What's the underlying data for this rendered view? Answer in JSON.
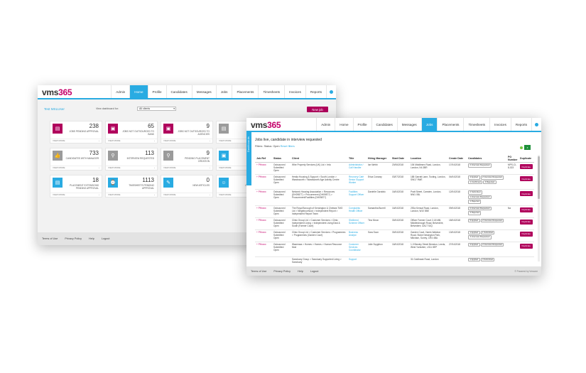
{
  "back": {
    "logo": {
      "part1": "vms",
      "part2": "365"
    },
    "nav": [
      "Admin",
      "Home",
      "Profile",
      "Candidates",
      "Messages",
      "Jobs",
      "Placements",
      "Timesheets",
      "Invoices",
      "Reports"
    ],
    "active_nav": "Home",
    "welcome": "Test MSLUser",
    "dashboard_for_label": "View dashboard for:",
    "dashboard_for_value": "All clients",
    "new_job_label": "New job",
    "tiles": [
      {
        "num": "238",
        "label": "Jobs pending approval",
        "icon": "clipboard-icon",
        "color": "pink"
      },
      {
        "num": "65",
        "label": "Jobs not outsourced to bank",
        "icon": "save-icon",
        "color": "pink"
      },
      {
        "num": "9",
        "label": "Jobs not outsourced to agencies",
        "icon": "save-icon",
        "color": "pink"
      },
      {
        "num": "",
        "label": "",
        "icon": "clipboard-icon",
        "color": "grey"
      },
      {
        "num": "733",
        "label": "Candidates with manager",
        "icon": "thumbs-up-icon",
        "color": "grey"
      },
      {
        "num": "113",
        "label": "Interview requested",
        "icon": "user-search-icon",
        "color": "grey"
      },
      {
        "num": "9",
        "label": "Pending placement creation",
        "icon": "user-search-icon",
        "color": "grey"
      },
      {
        "num": "",
        "label": "",
        "icon": "save-icon",
        "color": "blue"
      },
      {
        "num": "18",
        "label": "Placement extensions pending approval",
        "icon": "clipboard-icon",
        "color": "blue"
      },
      {
        "num": "1113",
        "label": "Timesheets pending approval",
        "icon": "timesheet-icon",
        "color": "blue"
      },
      {
        "num": "0",
        "label": "New articles",
        "icon": "article-icon",
        "color": "blue"
      },
      {
        "num": "",
        "label": "Candidates in c",
        "icon": "user-icon",
        "color": "blue"
      }
    ],
    "view_more": "View more",
    "footer": [
      "Terms of Use",
      "Privacy Policy",
      "Help",
      "Logout"
    ]
  },
  "front": {
    "logo": {
      "part1": "vms",
      "part2": "365"
    },
    "nav": [
      "Admin",
      "Home",
      "Profile",
      "Candidates",
      "Messages",
      "Jobs",
      "Placements",
      "Timesheets",
      "Invoices",
      "Reports"
    ],
    "active_nav": "Jobs",
    "side_tab": "Dashboards",
    "title": "Jobs live, candidate in interview requested",
    "filters_prefix": "Filters: Status: Open",
    "reset_filters": "Reset filters",
    "columns": [
      "Job Ref",
      "Status",
      "Client",
      "Title",
      "Hiring Manager",
      "Start Date",
      "Location",
      "Create Date",
      "Candidates",
      "PO Number",
      "Duplicate"
    ],
    "rows": [
      {
        "ref": "PHxxxx",
        "status": "Outsourced Submitted Open",
        "client": "Whe Property Services (UK) Ltd > Irrla",
        "title": "Administrator / Call Handler",
        "manager": "Ian Webb",
        "start": "20/06/2018",
        "location": "106 Middlesex Road, London, London, N4 3BR",
        "create": "17/04/2018",
        "candidates": [
          "2 Interview Requested"
        ],
        "po": "MPS-CI-8-023",
        "dup": "Duplicate",
        "tall": false
      },
      {
        "ref": "PHxxxx",
        "status": "Outsourced Submitted Open",
        "client": "Hestia Housing & Support > South London > Wandsworth > Wandsworth Age Activity Centre",
        "title": "Recovery Café Senior Support Worker",
        "manager": "Erica Conway",
        "start": "03/07/2018",
        "location": "188 Garratt Lane, Tooting, London, SW17 9WE",
        "create": "04/04/2018",
        "candidates": [
          "4 Applied",
          "2 Interview Requested",
          "1 Confirmed",
          "3 Rejected"
        ],
        "po": "",
        "dup": "Duplicate",
        "tall": true
      },
      {
        "ref": "PHxxxx",
        "status": "Outsourced Submitted Open",
        "client": "Network Housing Association > Resources (DH09877) > Procurement (DH09877) > Procurement/Facilities (DH09877)",
        "title": "Facilities Support Officer",
        "manager": "Danielle Garofalo",
        "start": "16/04/2018",
        "location": "Pratt Street, Camden, London, NW1 0BL",
        "create": "12/04/2018",
        "candidates": [
          "2 Submitted",
          "1 Interview Requested",
          "1 Rejected"
        ],
        "po": "",
        "dup": "Duplicate",
        "tall": true
      },
      {
        "ref": "PHxxxx",
        "status": "Outsourced Submitted Open",
        "client": "The Royal Borough of Kensington & Chelsea TMO Ltd > Neighbourhood > Independent Report > Independent Report Team",
        "title": "Complaints Health Officer",
        "manager": "Samantha Burrell",
        "start": "16/04/2018",
        "location": "292a Kensal Road, London, London, W10 5BE",
        "create": "09/04/2018",
        "candidates": [
          "2 Interview Requested",
          "4 Rejected"
        ],
        "po": "Na",
        "dup": "Duplicate",
        "tall": false
      },
      {
        "ref": "PHxxxx",
        "status": "Outsourced Submitted Open",
        "client": "Clinic Group Ltd > Customer Services > Clinic Independent Living > Independent Living East & South (Farmer Court)",
        "title": "Sheltered Scheme Officer",
        "manager": "Tina Nixon",
        "start": "30/04/2018",
        "location": "Officer Farmer Court 2-18 Mill, Middlesbrough Road, Belvedere, Belvedere, DA17 5JQ",
        "create": "18/04/2018",
        "candidates": [
          "5 Applied",
          "2 Interview Requested"
        ],
        "po": "",
        "dup": "Duplicate",
        "tall": false
      },
      {
        "ref": "PHxxxx",
        "status": "Outsourced Submitted Open",
        "client": "Clinic Group Ltd > Customer Services > Programmes > Programmes (Garden Court)",
        "title": "Business Analyst",
        "manager": "Sara Soon",
        "start": "30/04/2018",
        "location": "Garden Court, Harris Waldron Road, Stoke Newington Park, Mitcham, Surrey, CR4 4BA",
        "create": "13/04/2018",
        "candidates": [
          "1 Applied",
          "1 Submitted",
          "3 Interview Requested"
        ],
        "po": "",
        "dup": "Duplicate",
        "tall": false
      },
      {
        "ref": "PHxxxx",
        "status": "Outsourced Submitted Open",
        "client": "Wazemaa > Homes > Homes > Human Resource Mod",
        "title": "Customer Services Coordinator",
        "manager": "Julie Scyghton",
        "start": "16/04/2018",
        "location": "1-3 Bewley Street Beeston, Leeds, West Yorkshire, LS11 8EP",
        "create": "27/04/2018",
        "candidates": [
          "4 Applied",
          "2 Interview Requested"
        ],
        "po": "",
        "dup": "Duplicate",
        "tall": true
      },
      {
        "ref": "",
        "status": "",
        "client": "Sanctuary Group > Sanctuary Supported Living > Sanctuary",
        "title": "Support",
        "manager": "",
        "start": "",
        "location": "31 Goldhawk Road, London",
        "create": "",
        "candidates": [
          "1 Applied",
          "4 Submitted"
        ],
        "po": "",
        "dup": "",
        "tall": false
      }
    ],
    "footer": [
      "Terms of Use",
      "Privacy Policy",
      "Help",
      "Logout"
    ],
    "powered": "© Powered by Vmsone"
  }
}
